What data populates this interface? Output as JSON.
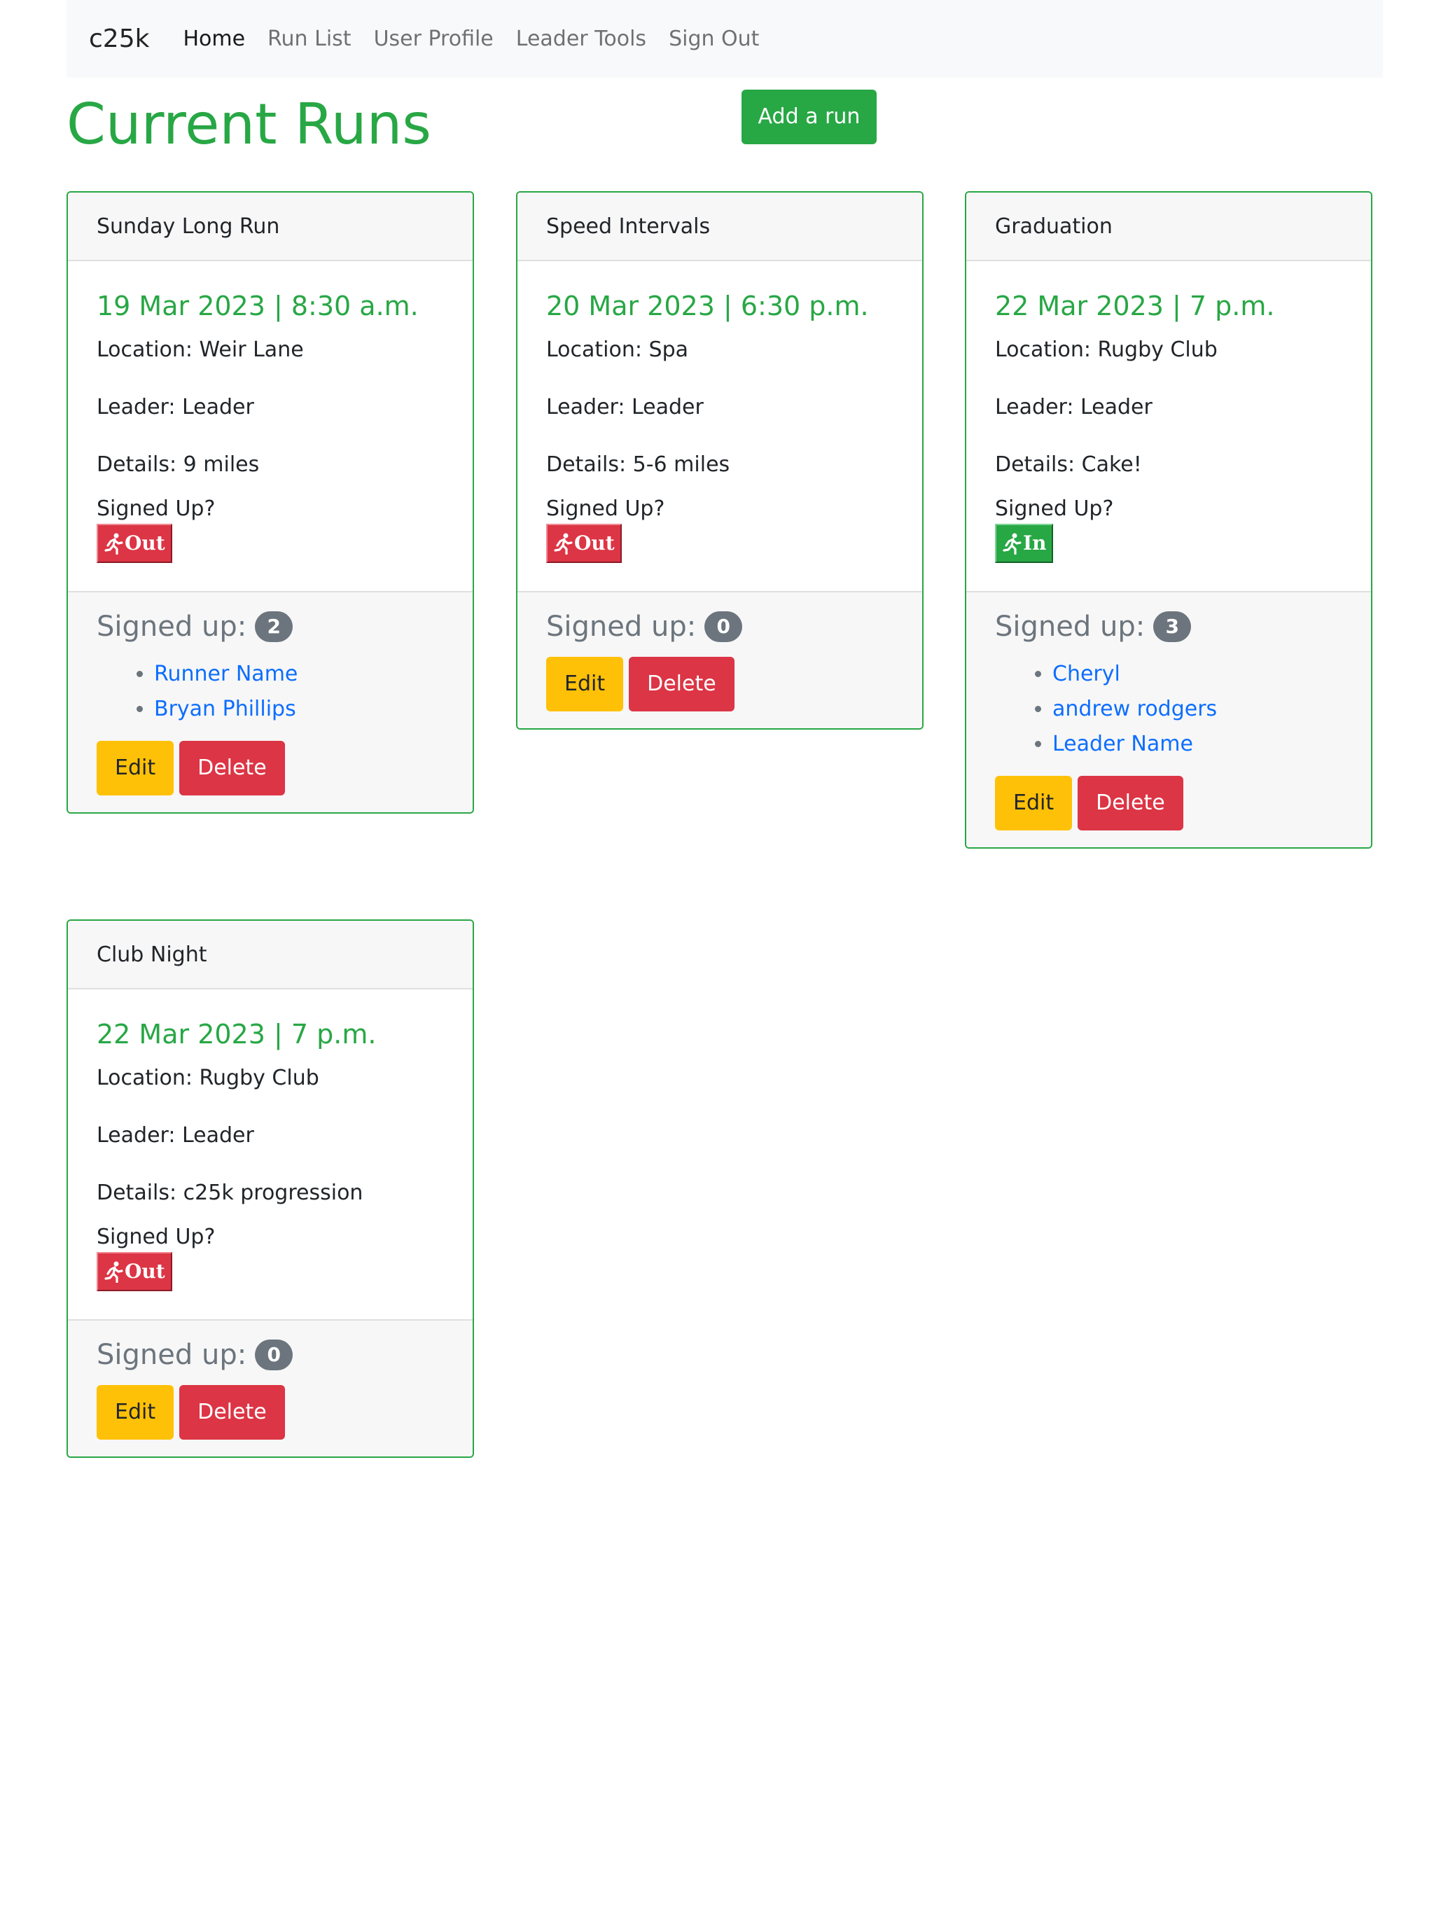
{
  "nav": {
    "brand": "c25k",
    "items": [
      "Home",
      "Run List",
      "User Profile",
      "Leader Tools",
      "Sign Out"
    ]
  },
  "page": {
    "title": "Current Runs",
    "add_run_label": "Add a run"
  },
  "labels": {
    "signed_up_question": "Signed Up?",
    "signed_up_count": "Signed up:",
    "edit": "Edit",
    "delete": "Delete"
  },
  "cards": [
    {
      "title": "Sunday Long Run",
      "datetime": "19 Mar 2023 | 8:30 a.m.",
      "location": "Location: Weir Lane",
      "leader": "Leader: Leader",
      "details": "Details: 9 miles",
      "status": "Out",
      "count": "2",
      "runners": [
        "Runner Name",
        "Bryan Phillips"
      ]
    },
    {
      "title": "Speed Intervals",
      "datetime": "20 Mar 2023 | 6:30 p.m.",
      "location": "Location: Spa",
      "leader": "Leader: Leader",
      "details": "Details: 5-6 miles",
      "status": "Out",
      "count": "0",
      "runners": []
    },
    {
      "title": "Graduation",
      "datetime": "22 Mar 2023 | 7 p.m.",
      "location": "Location: Rugby Club",
      "leader": "Leader: Leader",
      "details": "Details: Cake!",
      "status": "In",
      "count": "3",
      "runners": [
        "Cheryl",
        "andrew rodgers",
        "Leader Name"
      ]
    },
    {
      "title": "Club Night",
      "datetime": "22 Mar 2023 | 7 p.m.",
      "location": "Location: Rugby Club",
      "leader": "Leader: Leader",
      "details": "Details: c25k progression",
      "status": "Out",
      "count": "0",
      "runners": []
    }
  ],
  "colors": {
    "accent": "#28a745",
    "danger": "#dc3545",
    "warning": "#ffc107",
    "link": "#0d6efd",
    "muted": "#6c757d"
  }
}
